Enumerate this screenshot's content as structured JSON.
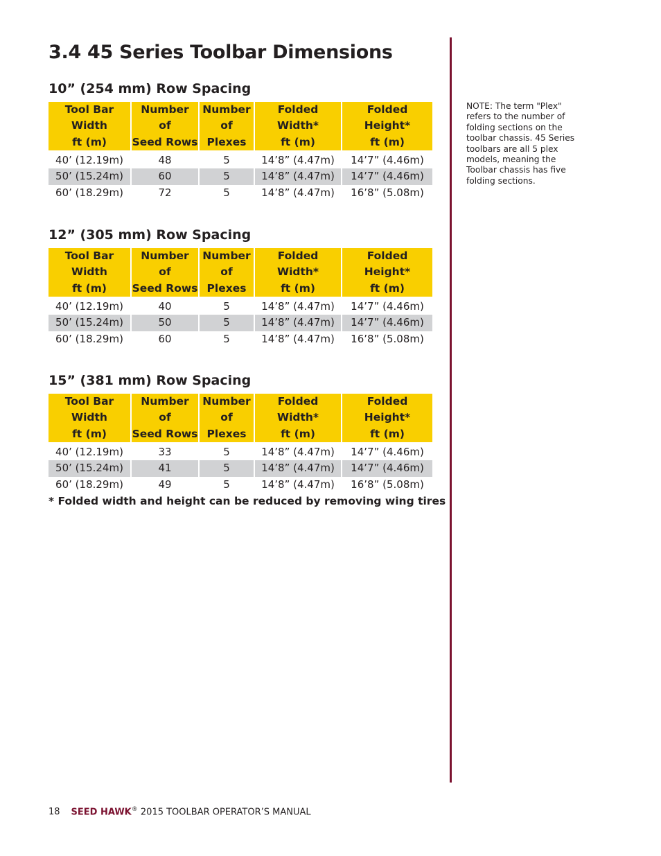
{
  "page": {
    "title": "3.4 45 Series Toolbar Dimensions"
  },
  "table_headers": [
    [
      "Tool Bar",
      "Width",
      "ft (m)"
    ],
    [
      "Number",
      "of",
      "Seed Rows"
    ],
    [
      "Number",
      "of",
      "Plexes"
    ],
    [
      "Folded",
      "Width*",
      "ft (m)"
    ],
    [
      "Folded",
      "Height*",
      "ft (m)"
    ]
  ],
  "sections": [
    {
      "heading": "10” (254 mm) Row Spacing",
      "rows": [
        [
          "40’ (12.19m)",
          "48",
          "5",
          "14’8” (4.47m)",
          "14’7” (4.46m)"
        ],
        [
          "50’ (15.24m)",
          "60",
          "5",
          "14’8” (4.47m)",
          "14’7” (4.46m)"
        ],
        [
          "60’ (18.29m)",
          "72",
          "5",
          "14’8” (4.47m)",
          "16’8” (5.08m)"
        ]
      ]
    },
    {
      "heading": "12” (305 mm) Row Spacing",
      "rows": [
        [
          "40’ (12.19m)",
          "40",
          "5",
          "14’8” (4.47m)",
          "14’7” (4.46m)"
        ],
        [
          "50’ (15.24m)",
          "50",
          "5",
          "14’8” (4.47m)",
          "14’7” (4.46m)"
        ],
        [
          "60’ (18.29m)",
          "60",
          "5",
          "14’8” (4.47m)",
          "16’8” (5.08m)"
        ]
      ]
    },
    {
      "heading": "15” (381 mm) Row Spacing",
      "rows": [
        [
          "40’ (12.19m)",
          "33",
          "5",
          "14’8” (4.47m)",
          "14’7” (4.46m)"
        ],
        [
          "50’ (15.24m)",
          "41",
          "5",
          "14’8” (4.47m)",
          "14’7” (4.46m)"
        ],
        [
          "60’ (18.29m)",
          "49",
          "5",
          "14’8” (4.47m)",
          "16’8” (5.08m)"
        ]
      ]
    }
  ],
  "footnote": "* Folded width and height can be reduced by removing wing tires",
  "sidebar_note": "NOTE: The term \"Plex\" refers to the number of folding sections on the toolbar chassis. 45 Series toolbars are all 5 plex models, meaning the Toolbar chassis has five folding sections.",
  "footer": {
    "page_number": "18",
    "brand": "SEED HAWK",
    "registered": "®",
    "manual_title": " 2015 TOOLBAR OPERATOR’S MANUAL"
  },
  "colors": {
    "header_fill": "#f9cf00",
    "shaded_row": "#d1d2d4",
    "accent": "#7b1230"
  }
}
